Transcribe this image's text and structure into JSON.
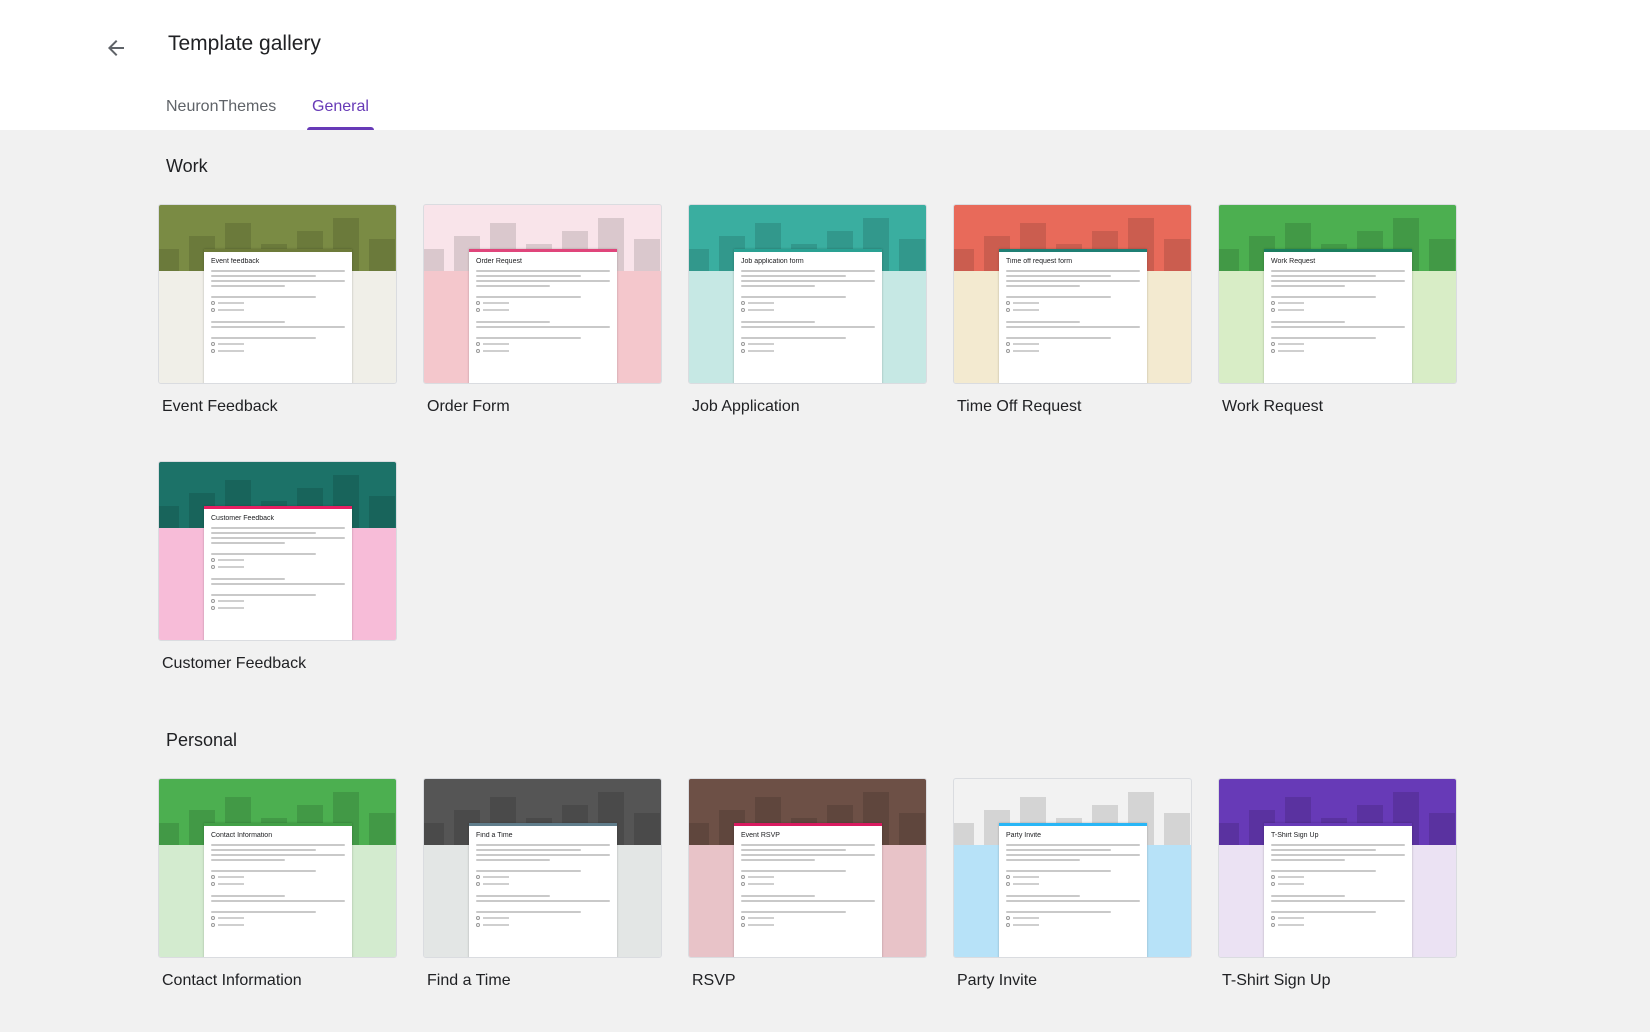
{
  "header": {
    "title": "Template gallery",
    "back_icon": "arrow-back-icon"
  },
  "tabs": [
    {
      "label": "NeuronThemes",
      "active": false
    },
    {
      "label": "General",
      "active": true
    }
  ],
  "colors": {
    "accent": "#673ab7",
    "background": "#f1f1f1",
    "text": "#202124"
  },
  "sections": {
    "work": {
      "title": "Work",
      "cards": [
        {
          "label": "Event Feedback",
          "form_title": "Event feedback",
          "accent": "#6d7b3a",
          "side": "#f0efe8",
          "banner": "#7a8b44"
        },
        {
          "label": "Order Form",
          "form_title": "Order Request",
          "accent": "#e0457b",
          "side": "#f4c7cc",
          "banner": "#f9e4ea"
        },
        {
          "label": "Job Application",
          "form_title": "Job application form",
          "accent": "#2aa193",
          "side": "#c6e8e4",
          "banner": "#3aaea0"
        },
        {
          "label": "Time Off Request",
          "form_title": "Time off request form",
          "accent": "#1f7f74",
          "side": "#f3ead0",
          "banner": "#e86a5a"
        },
        {
          "label": "Work Request",
          "form_title": "Work Request",
          "accent": "#1b7e5f",
          "side": "#d8edc6",
          "banner": "#4caf50"
        },
        {
          "label": "Customer Feedback",
          "form_title": "Customer Feedback",
          "accent": "#e91e63",
          "side": "#f7bcd8",
          "banner": "#1c7268"
        }
      ]
    },
    "personal": {
      "title": "Personal",
      "cards": [
        {
          "label": "Contact Information",
          "form_title": "Contact Information",
          "accent": "#43a047",
          "side": "#d3ebcf",
          "banner": "#4caf50"
        },
        {
          "label": "Find a Time",
          "form_title": "Find a Time",
          "accent": "#607d8b",
          "side": "#e3e6e5",
          "banner": "#555555"
        },
        {
          "label": "RSVP",
          "form_title": "Event RSVP",
          "accent": "#d81b60",
          "side": "#e8c3c8",
          "banner": "#6d5046"
        },
        {
          "label": "Party Invite",
          "form_title": "Party Invite",
          "accent": "#29b6f6",
          "side": "#b7e2f8",
          "banner": "#f2f2f2"
        },
        {
          "label": "T-Shirt Sign Up",
          "form_title": "T-Shirt Sign Up",
          "accent": "#673ab7",
          "side": "#ebe2f3",
          "banner": "#673ab7"
        }
      ]
    }
  }
}
